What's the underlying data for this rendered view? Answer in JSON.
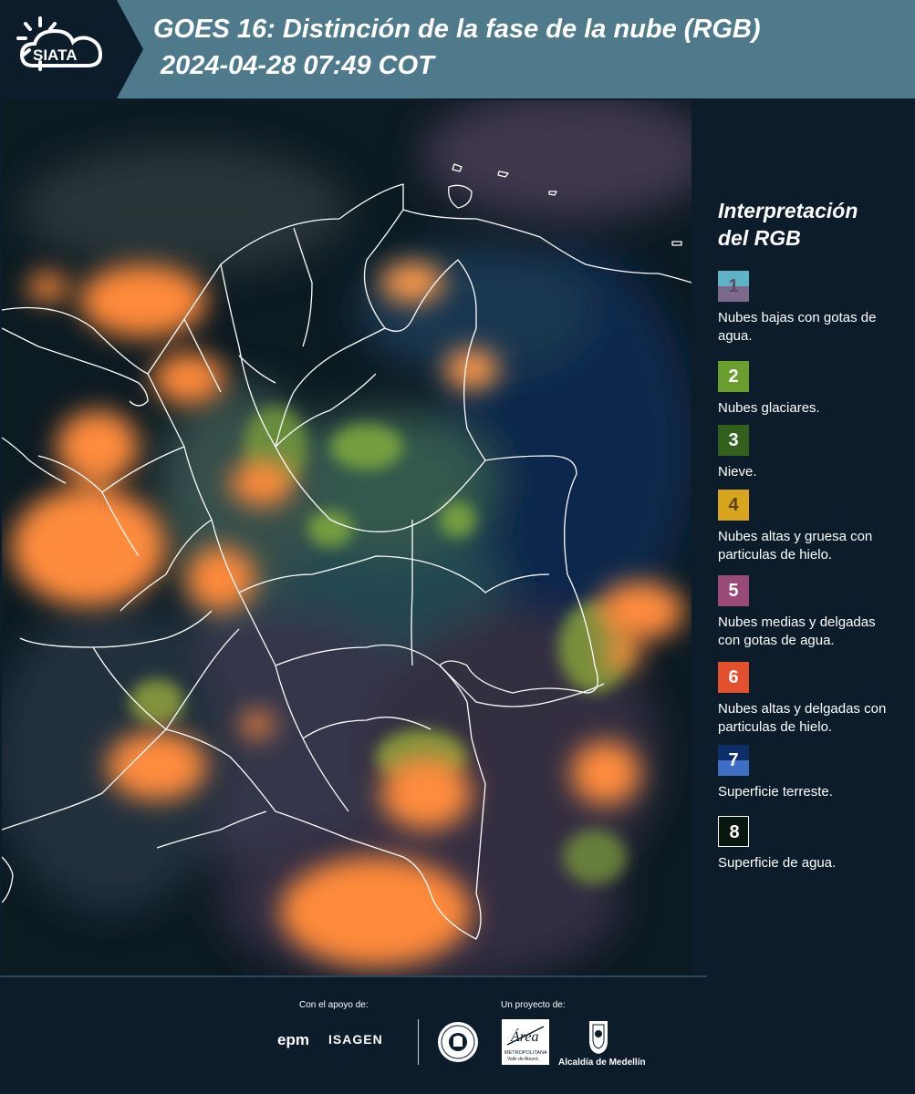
{
  "header": {
    "logo_text": "SIATA",
    "title_line1": "GOES 16: Distinción de la fase de la nube (RGB)",
    "title_line2": "2024-04-28 07:49 COT"
  },
  "legend": {
    "title_line1": "Interpretación",
    "title_line2": "del RGB",
    "items": [
      {
        "number": "1",
        "label": "Nubes bajas con gotas de agua.",
        "color_top": "#5fb3c6",
        "color_bottom": "#7b6a8c"
      },
      {
        "number": "2",
        "label": "Nubes glaciares.",
        "color": "#6a9e2e"
      },
      {
        "number": "3",
        "label": "Nieve.",
        "color": "#33601f"
      },
      {
        "number": "4",
        "label": "Nubes altas y gruesa con particulas de hielo.",
        "color": "#d9a51c"
      },
      {
        "number": "5",
        "label": "Nubes medias y delgadas con gotas de agua.",
        "color": "#9a4a78"
      },
      {
        "number": "6",
        "label": "Nubes altas y delgadas con particulas de hielo.",
        "color": "#e2502e"
      },
      {
        "number": "7",
        "label": "Superficie terreste.",
        "color_top": "#0d2e66",
        "color_bottom": "#3f6fc4"
      },
      {
        "number": "8",
        "label": "Superficie de agua.",
        "color": "#0a1710"
      }
    ]
  },
  "footer": {
    "support_label": "Con el apoyo de:",
    "sponsor_epm": "epm",
    "sponsor_isagen": "ISAGEN",
    "project_label": "Un proyecto de:",
    "area_logo_text": "Área",
    "area_logo_subtext": "METROPOLITANA",
    "area_logo_subtext2": "Valle de Aburrá",
    "alcaldia_label": "Alcaldía de Medellín"
  }
}
